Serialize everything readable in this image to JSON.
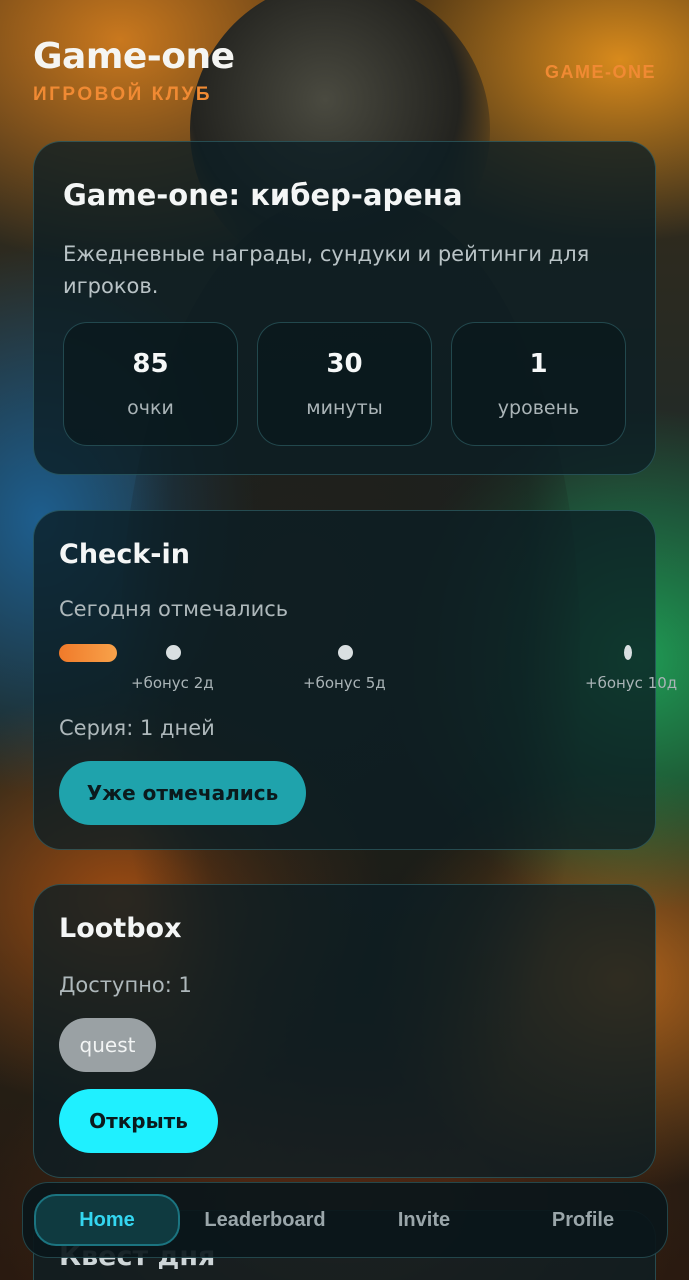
{
  "header": {
    "title": "Game-one",
    "subtitle": "ИГРОВОЙ КЛУБ",
    "top_right": "GAME-ONE"
  },
  "hero": {
    "title": "Game-one: кибер-арена",
    "description": "Ежедневные награды, сундуки и рейтинги для игроков.",
    "stats": [
      {
        "value": "85",
        "label": "очки"
      },
      {
        "value": "30",
        "label": "минуты"
      },
      {
        "value": "1",
        "label": "уровень"
      }
    ]
  },
  "checkin": {
    "title": "Check-in",
    "status": "Сегодня отмечались",
    "bonuses": [
      "+бонус 2д",
      "+бонус 5д",
      "+бонус 10д"
    ],
    "streak": "Серия: 1 дней",
    "button": "Уже отмечались"
  },
  "lootbox": {
    "title": "Lootbox",
    "available": "Доступно: 1",
    "chip": "quest",
    "button": "Открыть"
  },
  "quest": {
    "title": "Квест дня"
  },
  "nav": {
    "items": [
      "Home",
      "Leaderboard",
      "Invite",
      "Profile"
    ],
    "active": "Home"
  },
  "colors": {
    "accent_orange": "#f08a33",
    "accent_cyan": "#1ff0ff",
    "button_teal": "#1fa3ac"
  }
}
